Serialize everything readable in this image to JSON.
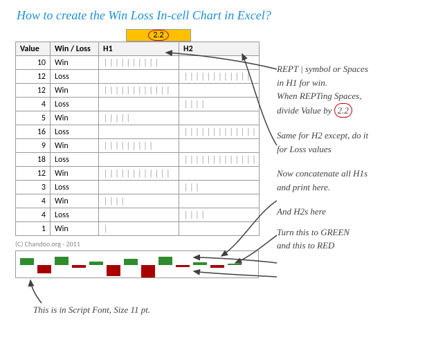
{
  "title": "How to create the Win Loss In-cell Chart in Excel?",
  "divisor": "2.2",
  "headers": {
    "value": "Value",
    "winloss": "Win / Loss",
    "h1": "H1",
    "h2": "H2"
  },
  "rows": [
    {
      "value": 10,
      "wl": "Win",
      "h1": "||||||||||",
      "h2": ""
    },
    {
      "value": 12,
      "wl": "Loss",
      "h1": "",
      "h2": "||||||||||||"
    },
    {
      "value": 12,
      "wl": "Win",
      "h1": "||||||||||||",
      "h2": ""
    },
    {
      "value": 4,
      "wl": "Loss",
      "h1": "",
      "h2": "||||"
    },
    {
      "value": 5,
      "wl": "Win",
      "h1": "|||||",
      "h2": ""
    },
    {
      "value": 16,
      "wl": "Loss",
      "h1": "",
      "h2": "||||||||||||||||"
    },
    {
      "value": 9,
      "wl": "Win",
      "h1": "|||||||||",
      "h2": ""
    },
    {
      "value": 18,
      "wl": "Loss",
      "h1": "",
      "h2": "||||||||||||||||||"
    },
    {
      "value": 12,
      "wl": "Win",
      "h1": "||||||||||||",
      "h2": ""
    },
    {
      "value": 3,
      "wl": "Loss",
      "h1": "",
      "h2": "|||"
    },
    {
      "value": 4,
      "wl": "Win",
      "h1": "||||",
      "h2": ""
    },
    {
      "value": 4,
      "wl": "Loss",
      "h1": "",
      "h2": "||||"
    },
    {
      "value": 1,
      "wl": "Win",
      "h1": "|",
      "h2": ""
    }
  ],
  "credit": "(C) Chandoo.org - 2011",
  "notes": {
    "n1a": "REPT | symbol or Spaces",
    "n1b": "in H1 for win.",
    "n1c": "When REPTing Spaces,",
    "n1d_pre": "divide Value by ",
    "n1d_val": "2.2",
    "n2a": "Same for H2 except, do it",
    "n2b": "for Loss values",
    "n3a": "Now concatenate all H1s",
    "n3b": "and print here.",
    "n4": "And H2s here",
    "n5a": "Turn this to GREEN",
    "n5b": "and this to RED",
    "caption": "This is in Script Font, Size 11 pt."
  },
  "spark": [
    {
      "v": 10,
      "wl": "Win"
    },
    {
      "v": 12,
      "wl": "Loss"
    },
    {
      "v": 12,
      "wl": "Win"
    },
    {
      "v": 4,
      "wl": "Loss"
    },
    {
      "v": 5,
      "wl": "Win"
    },
    {
      "v": 16,
      "wl": "Loss"
    },
    {
      "v": 9,
      "wl": "Win"
    },
    {
      "v": 18,
      "wl": "Loss"
    },
    {
      "v": 12,
      "wl": "Win"
    },
    {
      "v": 3,
      "wl": "Loss"
    },
    {
      "v": 4,
      "wl": "Win"
    },
    {
      "v": 4,
      "wl": "Loss"
    },
    {
      "v": 1,
      "wl": "Win"
    }
  ]
}
